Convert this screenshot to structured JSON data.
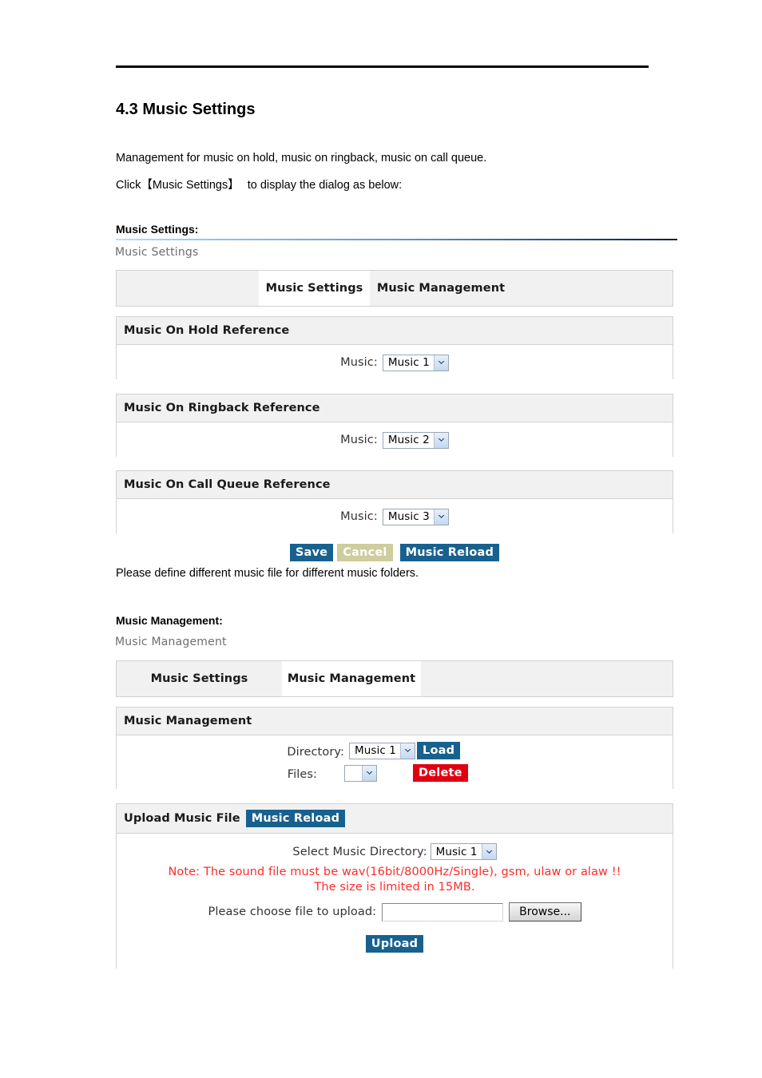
{
  "document": {
    "heading": "4.3 Music Settings",
    "paragraph1": "Management for music on hold, music on ringback, music on call queue.",
    "paragraph2_prefix": "Click",
    "paragraph2_bracketed": "【Music Settings】",
    "paragraph2_suffix": "to display the dialog as below:",
    "note_between_panels": "Please define different music file for different music folders."
  },
  "section_settings": {
    "label": "Music Settings:",
    "caption": "Music Settings",
    "tabs": [
      {
        "label": "",
        "active": false
      },
      {
        "label": "Music Settings",
        "active": true
      },
      {
        "label": "Music Management",
        "active": false
      }
    ],
    "blocks": [
      {
        "title": "Music On Hold Reference",
        "field_label": "Music:",
        "select_value": "Music 1"
      },
      {
        "title": "Music On Ringback Reference",
        "field_label": "Music:",
        "select_value": "Music 2"
      },
      {
        "title": "Music On Call Queue Reference",
        "field_label": "Music:",
        "select_value": "Music 3"
      }
    ],
    "buttons": {
      "save": "Save",
      "cancel": "Cancel",
      "music_reload": "Music Reload"
    }
  },
  "section_management": {
    "label": "Music Management:",
    "caption": "Music Management",
    "tabs": [
      {
        "label": "Music Settings",
        "active": false
      },
      {
        "label": "Music Management",
        "active": true
      },
      {
        "label": "",
        "active": false
      }
    ],
    "management_block": {
      "title": "Music Management",
      "directory_label": "Directory:",
      "directory_value": "Music 1",
      "load_button": "Load",
      "files_label": "Files:",
      "files_value": "",
      "delete_button": "Delete"
    },
    "upload_block": {
      "title": "Upload Music File",
      "music_reload_button": "Music Reload",
      "select_directory_label": "Select Music Directory:",
      "select_directory_value": "Music 1",
      "note_line1": "Note: The sound file must be wav(16bit/8000Hz/Single), gsm, ulaw or alaw !!",
      "note_line2": "The size is limited in 15MB.",
      "choose_file_label": "Please choose file to upload:",
      "file_input_value": "",
      "browse_button": "Browse...",
      "upload_button": "Upload"
    }
  },
  "colors": {
    "button_blue": "#18618f",
    "button_khaki": "#cfcc9e",
    "button_red": "#e00012",
    "note_red": "#ff2a2a",
    "panel_header_gray": "#f1f1f1",
    "panel_border": "#d2d2d2"
  }
}
